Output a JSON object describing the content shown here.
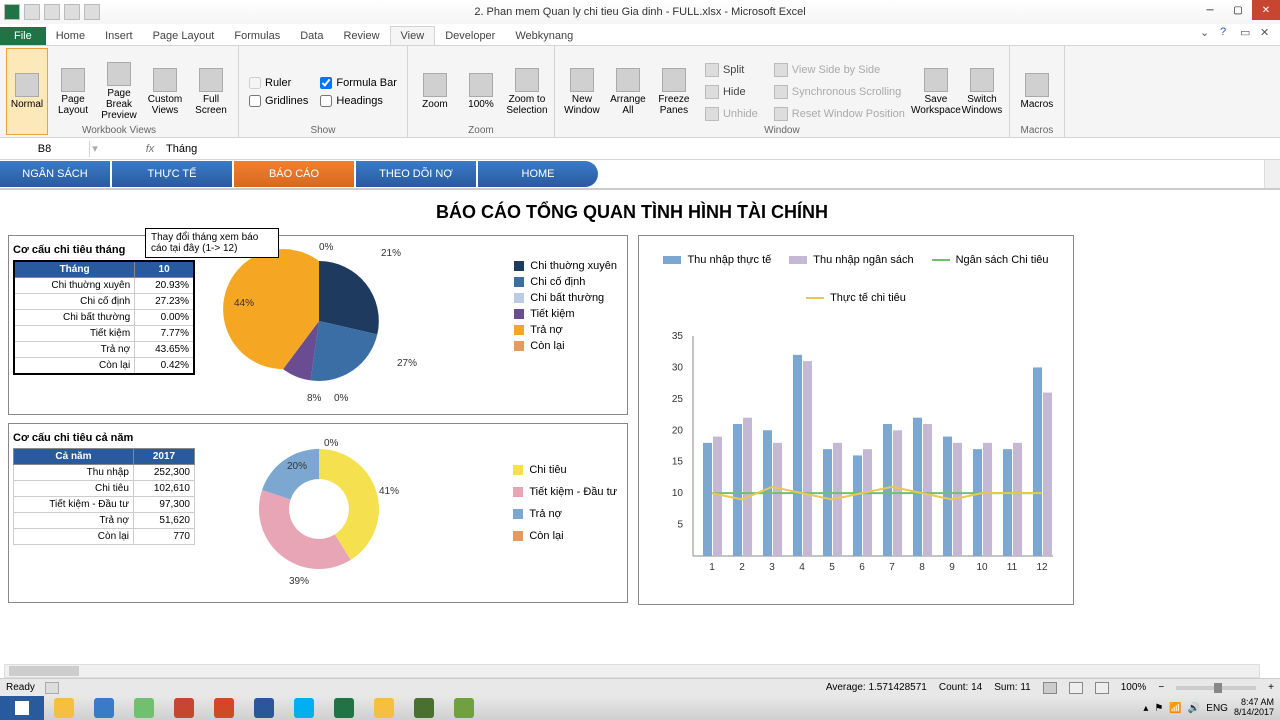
{
  "window": {
    "title": "2. Phan mem Quan ly chi tieu Gia dinh - FULL.xlsx - Microsoft Excel"
  },
  "ribbon": {
    "file": "File",
    "tabs": [
      "Home",
      "Insert",
      "Page Layout",
      "Formulas",
      "Data",
      "Review",
      "View",
      "Developer",
      "Webkynang"
    ],
    "active_tab": "View",
    "groups": {
      "views": {
        "label": "Workbook Views",
        "normal": "Normal",
        "page_layout": "Page\nLayout",
        "page_break": "Page Break\nPreview",
        "custom": "Custom\nViews",
        "full": "Full\nScreen"
      },
      "show": {
        "label": "Show",
        "ruler": "Ruler",
        "gridlines": "Gridlines",
        "formula_bar": "Formula Bar",
        "headings": "Headings"
      },
      "zoom": {
        "label": "Zoom",
        "zoom": "Zoom",
        "pct": "100%",
        "sel": "Zoom to\nSelection"
      },
      "window": {
        "label": "Window",
        "new": "New\nWindow",
        "arrange": "Arrange\nAll",
        "freeze": "Freeze\nPanes",
        "split": "Split",
        "hide": "Hide",
        "unhide": "Unhide",
        "side": "View Side by Side",
        "sync": "Synchronous Scrolling",
        "reset": "Reset Window Position",
        "save_ws": "Save\nWorkspace",
        "switch": "Switch\nWindows"
      },
      "macros": {
        "label": "Macros",
        "macros": "Macros"
      }
    }
  },
  "formula": {
    "cell": "B8",
    "value": "Tháng"
  },
  "nav": {
    "ngan_sach": "NGÂN SÁCH",
    "thuc_te": "THỰC TẾ",
    "bao_cao": "BÁO CÁO",
    "theo_doi": "THEO DÕI NỢ",
    "home": "HOME"
  },
  "report": {
    "title": "BÁO CÁO TỔNG QUAN TÌNH HÌNH TÀI CHÍNH"
  },
  "callout": "Thay đổi tháng xem báo cáo tại đây (1-> 12)",
  "month_table": {
    "title": "Cơ cấu chi tiêu tháng",
    "h1": "Tháng",
    "h2": "10",
    "rows": [
      [
        "Chi thuờng xuyên",
        "20.93%"
      ],
      [
        "Chi cố định",
        "27.23%"
      ],
      [
        "Chi bất thường",
        "0.00%"
      ],
      [
        "Tiết kiệm",
        "7.77%"
      ],
      [
        "Trả nợ",
        "43.65%"
      ],
      [
        "Còn lại",
        "0.42%"
      ]
    ]
  },
  "year_table": {
    "title": "Cơ cấu chi tiêu cả năm",
    "h1": "Cả năm",
    "h2": "2017",
    "rows": [
      [
        "Thu nhập",
        "252,300"
      ],
      [
        "Chi tiêu",
        "102,610"
      ],
      [
        "Tiết kiệm - Đầu tư",
        "97,300"
      ],
      [
        "Trả nợ",
        "51,620"
      ],
      [
        "Còn lại",
        "770"
      ]
    ]
  },
  "pie1_legend": [
    "Chi thuờng xuyên",
    "Chi cố định",
    "Chi bất thường",
    "Tiết kiệm",
    "Trả nợ",
    "Còn lại"
  ],
  "pie2_legend": [
    "Chi tiêu",
    "Tiết kiệm - Đầu tư",
    "Trả nợ",
    "Còn lại"
  ],
  "bar_legend": [
    "Thu nhập thực tế",
    "Thu nhập ngân sách",
    "Ngân sách Chi tiêu",
    "Thực tế chi tiêu"
  ],
  "chart_data": [
    {
      "type": "pie",
      "title": "Cơ cấu chi tiêu tháng 10",
      "series": [
        {
          "name": "Chi thuờng xuyên",
          "value": 21,
          "color": "#1f3a5f"
        },
        {
          "name": "Chi cố định",
          "value": 27,
          "color": "#3a6ea5"
        },
        {
          "name": "Chi bất thường",
          "value": 0,
          "color": "#b8cce4"
        },
        {
          "name": "Tiết kiệm",
          "value": 8,
          "color": "#6a4c93"
        },
        {
          "name": "Trả nợ",
          "value": 44,
          "color": "#f5a623"
        },
        {
          "name": "Còn lại",
          "value": 0,
          "color": "#e89a5d"
        }
      ],
      "labels": [
        "0%",
        "21%",
        "27%",
        "8%",
        "0%",
        "44%"
      ]
    },
    {
      "type": "pie",
      "title": "Cơ cấu chi tiêu cả năm 2017",
      "hole": 0.5,
      "series": [
        {
          "name": "Chi tiêu",
          "value": 41,
          "color": "#f5e050"
        },
        {
          "name": "Tiết kiệm - Đầu tư",
          "value": 39,
          "color": "#e8a5b5"
        },
        {
          "name": "Trả nợ",
          "value": 20,
          "color": "#7ba7d0"
        },
        {
          "name": "Còn lại",
          "value": 0,
          "color": "#e89a5d"
        }
      ],
      "labels": [
        "41%",
        "39%",
        "20%",
        "0%"
      ]
    },
    {
      "type": "bar",
      "categories": [
        1,
        2,
        3,
        4,
        5,
        6,
        7,
        8,
        9,
        10,
        11,
        12
      ],
      "ylim": [
        0,
        35
      ],
      "yticks": [
        5,
        10,
        15,
        20,
        25,
        30,
        35
      ],
      "series": [
        {
          "name": "Thu nhập thực tế",
          "color": "#7ba7d0",
          "values": [
            18,
            21,
            20,
            32,
            17,
            16,
            21,
            22,
            19,
            17,
            17,
            30
          ]
        },
        {
          "name": "Thu nhập ngân sách",
          "color": "#c5b8d5",
          "values": [
            19,
            22,
            18,
            31,
            18,
            17,
            20,
            21,
            18,
            18,
            18,
            26
          ]
        },
        {
          "name": "Ngân sách Chi tiêu",
          "color": "#70c070",
          "values": [
            10,
            10,
            10,
            10,
            10,
            10,
            10,
            10,
            10,
            10,
            10,
            10
          ]
        },
        {
          "name": "Thực tế chi tiêu",
          "color": "#e8c850",
          "values": [
            10,
            9,
            11,
            10,
            9,
            10,
            11,
            10,
            9,
            10,
            10,
            10
          ]
        }
      ]
    }
  ],
  "status": {
    "ready": "Ready",
    "avg": "Average: 1.571428571",
    "count": "Count: 14",
    "sum": "Sum: 11",
    "zoom": "100%"
  },
  "systray": {
    "lang": "ENG",
    "time": "8:47 AM",
    "date": "8/14/2017"
  }
}
